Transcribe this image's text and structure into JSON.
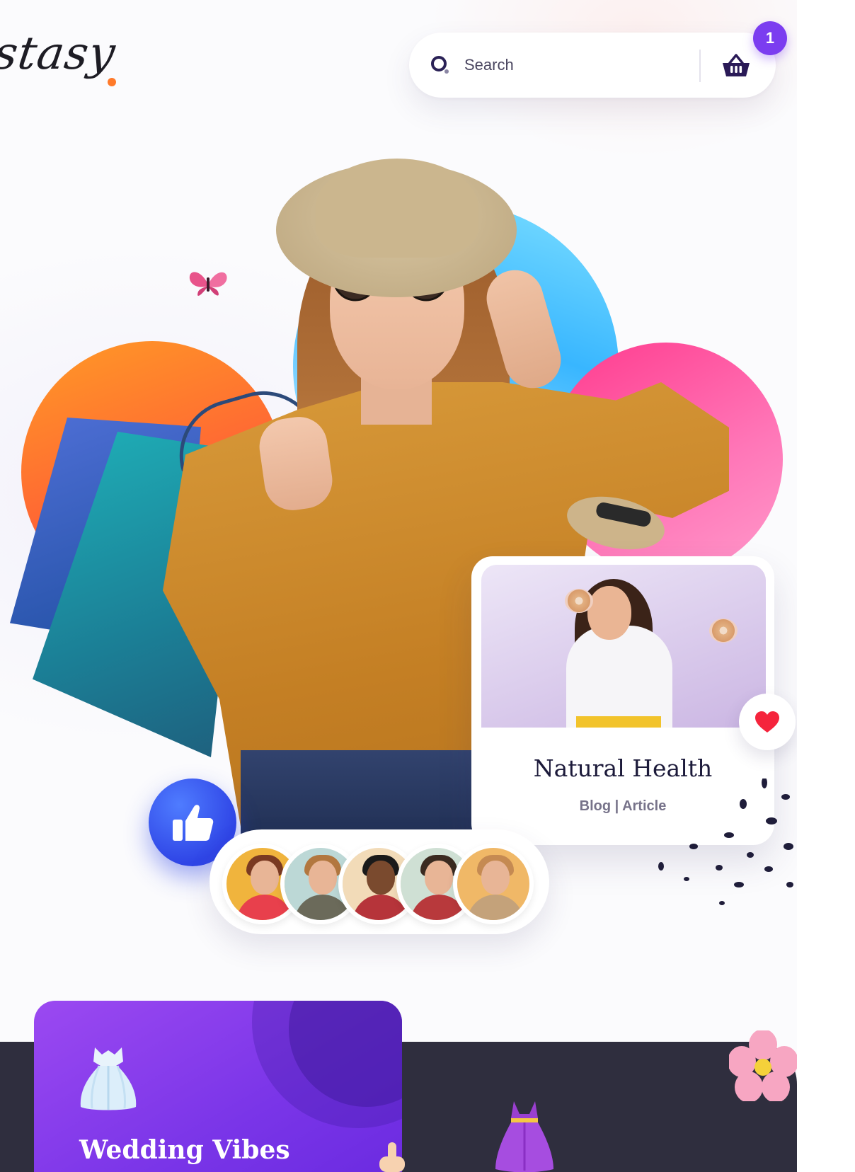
{
  "header": {
    "logo_text": "stasy",
    "search_placeholder": "Search",
    "cart_count": "1",
    "accent_color": "#7b3df0",
    "logo_dot_color": "#ff7a2a"
  },
  "hero": {
    "icons": [
      "butterfly-icon",
      "like-icon",
      "heart-icon"
    ],
    "circle_colors": [
      "#ff6a30",
      "#38b6ff",
      "#ff3a8d"
    ]
  },
  "article_card": {
    "title": "Natural Health",
    "meta": "Blog | Article"
  },
  "categories": {
    "cards": [
      {
        "title": "Wedding Vibes",
        "icon": "wedding-gown-icon"
      }
    ],
    "decor_icons": [
      "dress-icon",
      "flower-icon",
      "pointing-hand-icon"
    ]
  },
  "avatars": {
    "count": 5,
    "backgrounds": [
      "#f0b43d",
      "#bcd8d6",
      "#f2dbb8",
      "#cfe0d4",
      "#f0b867"
    ]
  }
}
